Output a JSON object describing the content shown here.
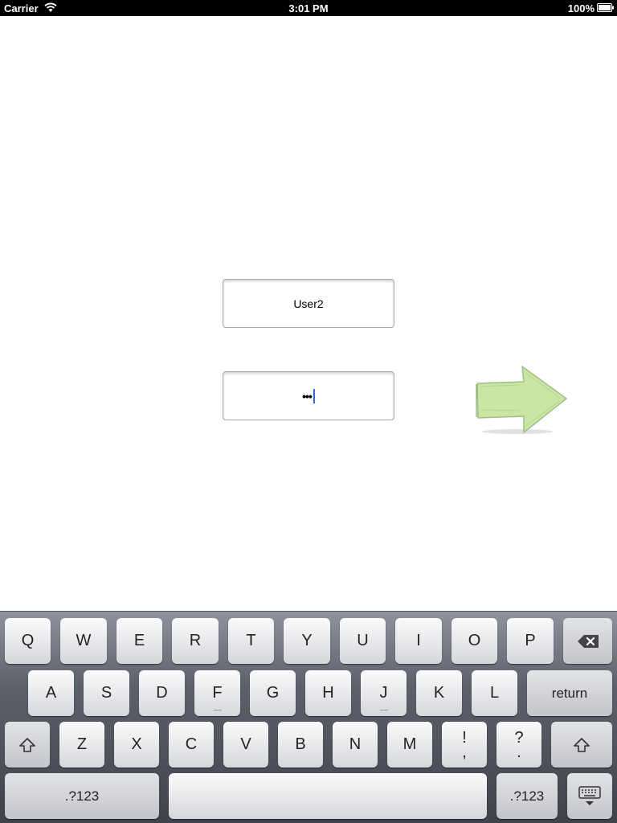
{
  "status_bar": {
    "carrier": "Carrier",
    "time": "3:01 PM",
    "battery": "100%",
    "icons": [
      "wifi-icon",
      "battery-icon"
    ]
  },
  "login": {
    "username_value": "User2",
    "password_mask": "•••",
    "submit_icon": "green-arrow-icon"
  },
  "keyboard": {
    "row1": [
      "Q",
      "W",
      "E",
      "R",
      "T",
      "Y",
      "U",
      "I",
      "O",
      "P"
    ],
    "row2": [
      "A",
      "S",
      "D",
      "F",
      "G",
      "H",
      "J",
      "K",
      "L"
    ],
    "return_label": "return",
    "row3": [
      "Z",
      "X",
      "C",
      "V",
      "B",
      "N",
      "M"
    ],
    "punct1_top": "!",
    "punct1_bottom": ",",
    "punct2_top": "?",
    "punct2_bottom": ".",
    "numbers_label": ".?123",
    "icons": [
      "backspace-icon",
      "shift-icon",
      "keyboard-dismiss-icon"
    ]
  },
  "colors": {
    "caret": "#2f6ae0",
    "arrow_fill": "#c9e6a4"
  }
}
